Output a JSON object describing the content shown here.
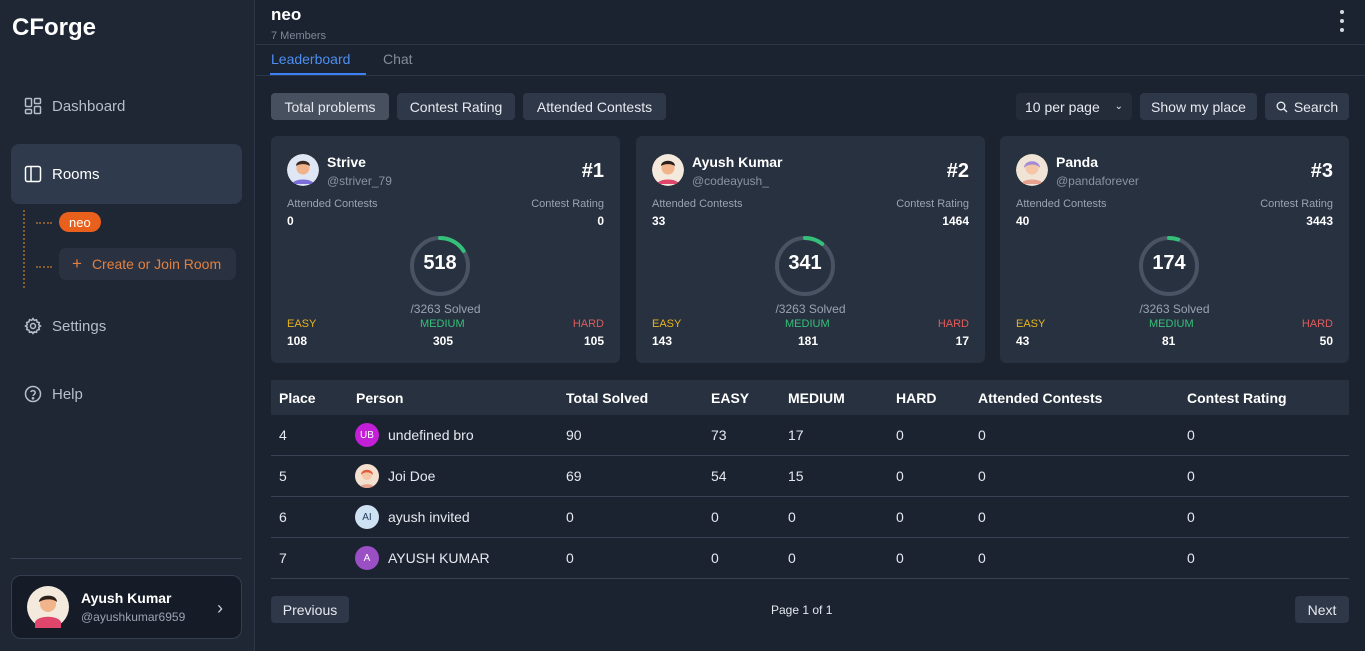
{
  "app": {
    "brand": "CForge"
  },
  "sidebar": {
    "items": [
      {
        "label": "Dashboard",
        "icon": "dashboard-icon"
      },
      {
        "label": "Rooms",
        "icon": "rooms-icon"
      },
      {
        "label": "Settings",
        "icon": "gear-icon"
      },
      {
        "label": "Help",
        "icon": "help-icon"
      }
    ],
    "rooms": [
      {
        "label": "neo"
      }
    ],
    "create_room_label": "Create or Join Room",
    "profile": {
      "name": "Ayush Kumar",
      "handle": "@ayushkumar6959"
    }
  },
  "header": {
    "room_name": "neo",
    "members": "7 Members"
  },
  "tabs": [
    {
      "label": "Leaderboard"
    },
    {
      "label": "Chat"
    }
  ],
  "filters": {
    "buttons": [
      {
        "label": "Total problems"
      },
      {
        "label": "Contest Rating"
      },
      {
        "label": "Attended Contests"
      }
    ],
    "per_page": "10 per page",
    "show_my_place": "Show my place",
    "search": "Search"
  },
  "card_labels": {
    "attended": "Attended Contests",
    "rating": "Contest Rating",
    "easy": "EASY",
    "medium": "MEDIUM",
    "hard": "HARD"
  },
  "top_three": [
    {
      "name": "Strive",
      "handle": "@striver_79",
      "rank": "#1",
      "attended": "0",
      "rating": "0",
      "solved": "518",
      "total": "/3263 Solved",
      "easy": "108",
      "medium": "305",
      "hard": "105",
      "progress": 0.159
    },
    {
      "name": "Ayush Kumar",
      "handle": "@codeayush_",
      "rank": "#2",
      "attended": "33",
      "rating": "1464",
      "solved": "341",
      "total": "/3263 Solved",
      "easy": "143",
      "medium": "181",
      "hard": "17",
      "progress": 0.105
    },
    {
      "name": "Panda",
      "handle": "@pandaforever",
      "rank": "#3",
      "attended": "40",
      "rating": "3443",
      "solved": "174",
      "total": "/3263 Solved",
      "easy": "43",
      "medium": "81",
      "hard": "50",
      "progress": 0.053
    }
  ],
  "table": {
    "headers": [
      "Place",
      "Person",
      "Total Solved",
      "EASY",
      "MEDIUM",
      "HARD",
      "Attended Contests",
      "Contest Rating"
    ],
    "rows": [
      {
        "place": "4",
        "initials": "UB",
        "name": "undefined bro",
        "total": "90",
        "easy": "73",
        "medium": "17",
        "hard": "0",
        "attended": "0",
        "rating": "0"
      },
      {
        "place": "5",
        "initials": "",
        "name": "Joi Doe",
        "total": "69",
        "easy": "54",
        "medium": "15",
        "hard": "0",
        "attended": "0",
        "rating": "0"
      },
      {
        "place": "6",
        "initials": "AI",
        "name": "ayush invited",
        "total": "0",
        "easy": "0",
        "medium": "0",
        "hard": "0",
        "attended": "0",
        "rating": "0"
      },
      {
        "place": "7",
        "initials": "A",
        "name": "AYUSH KUMAR",
        "total": "0",
        "easy": "0",
        "medium": "0",
        "hard": "0",
        "attended": "0",
        "rating": "0"
      }
    ]
  },
  "pagination": {
    "previous": "Previous",
    "page_text": "Page 1 of 1",
    "next": "Next"
  },
  "colors": {
    "accent": "#3b82f6",
    "orange": "#e8601c",
    "easy": "#e9b51c",
    "medium": "#35c07a",
    "hard": "#e05c5c"
  }
}
